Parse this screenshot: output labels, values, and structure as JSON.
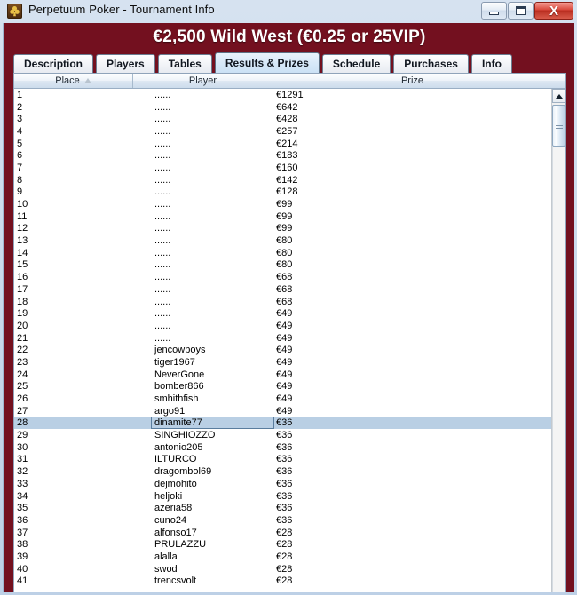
{
  "window": {
    "title": "Perpetuum Poker - Tournament Info",
    "icon": "club-suit-icon",
    "buttons": {
      "minimize": "minimize-button",
      "maximize": "maximize-button",
      "close_label": "X"
    }
  },
  "tournament": {
    "title": "€2,500 Wild West (€0.25 or 25VIP)"
  },
  "tabs": [
    {
      "label": "Description",
      "active": false
    },
    {
      "label": "Players",
      "active": false
    },
    {
      "label": "Tables",
      "active": false
    },
    {
      "label": "Results & Prizes",
      "active": true
    },
    {
      "label": "Schedule",
      "active": false
    },
    {
      "label": "Purchases",
      "active": false
    },
    {
      "label": "Info",
      "active": false
    }
  ],
  "table": {
    "columns": [
      {
        "label": "Place",
        "sorted": "ascending"
      },
      {
        "label": "Player",
        "sorted": ""
      },
      {
        "label": "Prize",
        "sorted": ""
      }
    ],
    "selected_place": "28",
    "rows": [
      {
        "place": "1",
        "player": "......",
        "prize": "€1291"
      },
      {
        "place": "2",
        "player": "......",
        "prize": "€642"
      },
      {
        "place": "3",
        "player": "......",
        "prize": "€428"
      },
      {
        "place": "4",
        "player": "......",
        "prize": "€257"
      },
      {
        "place": "5",
        "player": "......",
        "prize": "€214"
      },
      {
        "place": "6",
        "player": "......",
        "prize": "€183"
      },
      {
        "place": "7",
        "player": "......",
        "prize": "€160"
      },
      {
        "place": "8",
        "player": "......",
        "prize": "€142"
      },
      {
        "place": "9",
        "player": "......",
        "prize": "€128"
      },
      {
        "place": "10",
        "player": "......",
        "prize": "€99"
      },
      {
        "place": "11",
        "player": "......",
        "prize": "€99"
      },
      {
        "place": "12",
        "player": "......",
        "prize": "€99"
      },
      {
        "place": "13",
        "player": "......",
        "prize": "€80"
      },
      {
        "place": "14",
        "player": "......",
        "prize": "€80"
      },
      {
        "place": "15",
        "player": "......",
        "prize": "€80"
      },
      {
        "place": "16",
        "player": "......",
        "prize": "€68"
      },
      {
        "place": "17",
        "player": "......",
        "prize": "€68"
      },
      {
        "place": "18",
        "player": "......",
        "prize": "€68"
      },
      {
        "place": "19",
        "player": "......",
        "prize": "€49"
      },
      {
        "place": "20",
        "player": "......",
        "prize": "€49"
      },
      {
        "place": "21",
        "player": "......",
        "prize": "€49"
      },
      {
        "place": "22",
        "player": "jencowboys",
        "prize": "€49"
      },
      {
        "place": "23",
        "player": "tiger1967",
        "prize": "€49"
      },
      {
        "place": "24",
        "player": "NeverGone",
        "prize": "€49"
      },
      {
        "place": "25",
        "player": "bomber866",
        "prize": "€49"
      },
      {
        "place": "26",
        "player": "smhithfish",
        "prize": "€49"
      },
      {
        "place": "27",
        "player": "argo91",
        "prize": "€49"
      },
      {
        "place": "28",
        "player": "dinamite77",
        "prize": "€36"
      },
      {
        "place": "29",
        "player": "SINGHIOZZO",
        "prize": "€36"
      },
      {
        "place": "30",
        "player": "antonio205",
        "prize": "€36"
      },
      {
        "place": "31",
        "player": "ILTURCO",
        "prize": "€36"
      },
      {
        "place": "32",
        "player": "dragombol69",
        "prize": "€36"
      },
      {
        "place": "33",
        "player": "dejmohito",
        "prize": "€36"
      },
      {
        "place": "34",
        "player": "heljoki",
        "prize": "€36"
      },
      {
        "place": "35",
        "player": "azeria58",
        "prize": "€36"
      },
      {
        "place": "36",
        "player": "cuno24",
        "prize": "€36"
      },
      {
        "place": "37",
        "player": "alfonso17",
        "prize": "€28"
      },
      {
        "place": "38",
        "player": "PRULAZZU",
        "prize": "€28"
      },
      {
        "place": "39",
        "player": "alalla",
        "prize": "€28"
      },
      {
        "place": "40",
        "player": "swod",
        "prize": "€28"
      },
      {
        "place": "41",
        "player": "trencsvolt",
        "prize": "€28"
      }
    ]
  },
  "scrollbar": {
    "up_button": "scroll-up-button",
    "thumb": "scroll-thumb"
  },
  "colors": {
    "accent_maroon": "#73101f",
    "title_bar": "#cddcee",
    "selection_blue": "#b9cfe4",
    "active_tab": "#d6e8f8"
  }
}
